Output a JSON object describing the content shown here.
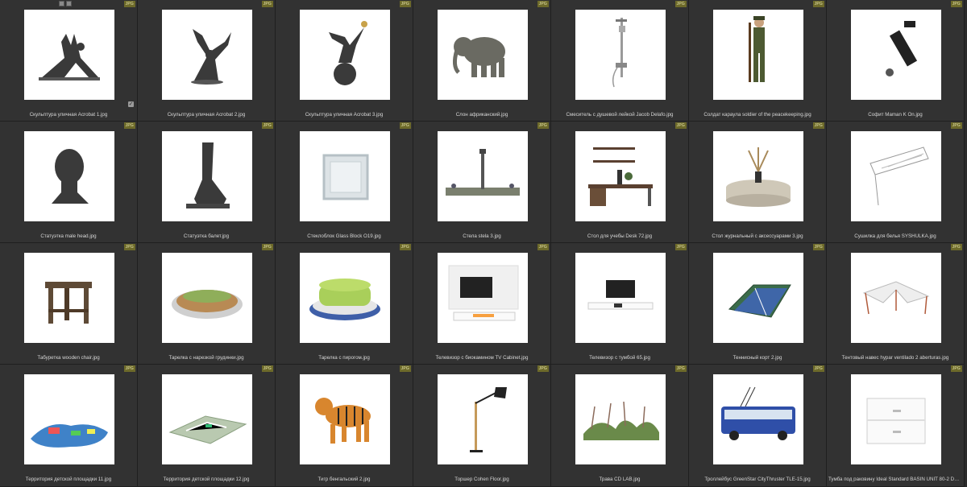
{
  "browser": {
    "badge_label": "JPG",
    "items": [
      {
        "name": "Скульптура уличная Acrobat 1.jpg",
        "icon": "acrobat-sculpture-1"
      },
      {
        "name": "Скульптура уличная Acrobat 2.jpg",
        "icon": "acrobat-sculpture-2"
      },
      {
        "name": "Скульптура уличная Acrobat 3.jpg",
        "icon": "acrobat-sculpture-3"
      },
      {
        "name": "Слон африканский.jpg",
        "icon": "elephant"
      },
      {
        "name": "Смеситель с душевой лейкой Jacob Delafo.jpg",
        "icon": "shower-mixer"
      },
      {
        "name": "Солдат караула soldier of the peacekeeping.jpg",
        "icon": "soldier"
      },
      {
        "name": "Софит Maman K On.jpg",
        "icon": "spotlight"
      },
      {
        "name": "Статуэтка male head.jpg",
        "icon": "male-head"
      },
      {
        "name": "Статуэтка балет.jpg",
        "icon": "ballet-foot"
      },
      {
        "name": "Стеклоблок Glass Block O19.jpg",
        "icon": "glass-block"
      },
      {
        "name": "Стела stela 3.jpg",
        "icon": "stela"
      },
      {
        "name": "Стол для учебы Desk 72.jpg",
        "icon": "desk"
      },
      {
        "name": "Стол журнальный с аксессуарами 3.jpg",
        "icon": "coffee-table"
      },
      {
        "name": "Сушилка для белья SYSHULKA.jpg",
        "icon": "laundry-dryer"
      },
      {
        "name": "Табуретка wooden chair.jpg",
        "icon": "wooden-stool"
      },
      {
        "name": "Тарелка с нарезкой грудинки.jpg",
        "icon": "plate-brisket"
      },
      {
        "name": "Тарелка с пирогом.jpg",
        "icon": "plate-pie"
      },
      {
        "name": "Телевизор с биокамином TV Cabinet.jpg",
        "icon": "tv-cabinet"
      },
      {
        "name": "Телевизор с тумбой 65.jpg",
        "icon": "tv-stand"
      },
      {
        "name": "Теннисный корт 2.jpg",
        "icon": "tennis-court"
      },
      {
        "name": "Тентовый навес hypar ventilado 2 aberturas.jpg",
        "icon": "tent-canopy"
      },
      {
        "name": "Территория детской площадки 11.jpg",
        "icon": "playground-11"
      },
      {
        "name": "Территория детской площадки 12.jpg",
        "icon": "playground-12"
      },
      {
        "name": "Тигр бенгальский 2.jpg",
        "icon": "tiger"
      },
      {
        "name": "Торшер Cohen Floor.jpg",
        "icon": "floor-lamp"
      },
      {
        "name": "Трава CD LAB.jpg",
        "icon": "grass"
      },
      {
        "name": "Троллейбус GreenStar CityThruster TLE-15.jpg",
        "icon": "trolleybus"
      },
      {
        "name": "Тумба под раковину Ideal Standard BASIN UNIT 80-2 DWS - ...",
        "icon": "basin-unit"
      }
    ]
  }
}
